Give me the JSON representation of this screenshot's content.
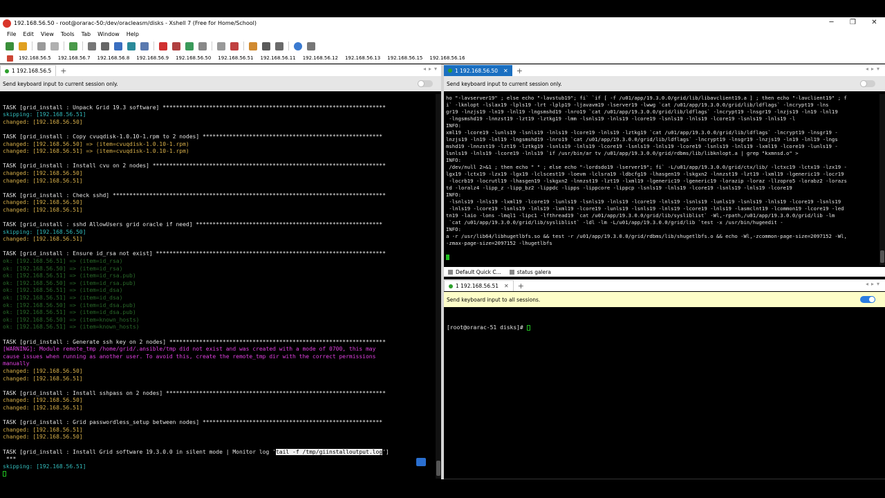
{
  "window": {
    "title": "192.168.56.50 - root@orarac-50:/dev/oracleasm/disks - Xshell 7 (Free for Home/School)",
    "controls": [
      "─",
      "❐",
      "✕"
    ]
  },
  "menu": [
    "File",
    "Edit",
    "View",
    "Tools",
    "Tab",
    "Window",
    "Help"
  ],
  "quick_hosts": [
    "192.168.56.5",
    "192.168.56.7",
    "192.168.56.8",
    "192.168.56.9",
    "192.168.56.50",
    "192.168.56.51",
    "192.168.56.11",
    "192.168.56.12",
    "192.168.56.13",
    "192.168.56.15",
    "192.168.56.16"
  ],
  "left_pane": {
    "tab_label": "1 192.168.56.5",
    "banner": "Send keyboard input to current session only.",
    "lines": [
      {
        "t": "",
        "c": "white"
      },
      {
        "t": "TASK [grid_install : Unpack Grid 19.3 software] *******************************************************************",
        "c": "white"
      },
      {
        "t": "skipping: [192.168.56.51]",
        "c": "cyan"
      },
      {
        "t": "changed: [192.168.56.50]",
        "c": "yellow"
      },
      {
        "t": "",
        "c": "white"
      },
      {
        "t": "TASK [grid_install : Copy cvuqdisk-1.0.10-1.rpm to 2 nodes] ******************************************************",
        "c": "white"
      },
      {
        "t": "changed: [192.168.56.50] => (item=cvuqdisk-1.0.10-1.rpm)",
        "c": "yellow"
      },
      {
        "t": "changed: [192.168.56.51] => (item=cvuqdisk-1.0.10-1.rpm)",
        "c": "yellow"
      },
      {
        "t": "",
        "c": "white"
      },
      {
        "t": "TASK [grid_install : Install cvu on 2 nodes] **********************************************************************",
        "c": "white"
      },
      {
        "t": "changed: [192.168.56.50]",
        "c": "yellow"
      },
      {
        "t": "changed: [192.168.56.51]",
        "c": "yellow"
      },
      {
        "t": "",
        "c": "white"
      },
      {
        "t": "TASK [grid_install : Check sshd] **********************************************************************************",
        "c": "white"
      },
      {
        "t": "changed: [192.168.56.50]",
        "c": "yellow"
      },
      {
        "t": "changed: [192.168.56.51]",
        "c": "yellow"
      },
      {
        "t": "",
        "c": "white"
      },
      {
        "t": "TASK [grid_install : sshd AllowUsers grid oracle if need] ********************************************************",
        "c": "white"
      },
      {
        "t": "skipping: [192.168.56.50]",
        "c": "cyan"
      },
      {
        "t": "changed: [192.168.56.51]",
        "c": "yellow"
      },
      {
        "t": "",
        "c": "white"
      },
      {
        "t": "TASK [grid_install : Ensure id_rsa not exist] *********************************************************************",
        "c": "white"
      },
      {
        "t": "ok: [192.168.56.51] => (item=id_rsa)",
        "c": "dgreen"
      },
      {
        "t": "ok: [192.168.56.50] => (item=id_rsa)",
        "c": "dgreen"
      },
      {
        "t": "ok: [192.168.56.51] => (item=id_rsa.pub)",
        "c": "dgreen"
      },
      {
        "t": "ok: [192.168.56.50] => (item=id_rsa.pub)",
        "c": "dgreen"
      },
      {
        "t": "ok: [192.168.56.51] => (item=id_dsa)",
        "c": "dgreen"
      },
      {
        "t": "ok: [192.168.56.51] => (item=id_dsa)",
        "c": "dgreen"
      },
      {
        "t": "ok: [192.168.56.50] => (item=id_dsa.pub)",
        "c": "dgreen"
      },
      {
        "t": "ok: [192.168.56.51] => (item=id_dsa.pub)",
        "c": "dgreen"
      },
      {
        "t": "ok: [192.168.56.50] => (item=known_hosts)",
        "c": "dgreen"
      },
      {
        "t": "ok: [192.168.56.51] => (item=known_hosts)",
        "c": "dgreen"
      },
      {
        "t": "",
        "c": "white"
      },
      {
        "t": "TASK [grid_install : Generate ssh key on 2 nodes] *****************************************************************",
        "c": "white"
      },
      {
        "t": "[WARNING]: Module remote_tmp /home/grid/.ansible/tmp did not exist and was created with a mode of 0700, this may",
        "c": "magenta"
      },
      {
        "t": "cause issues when running as another user. To avoid this, create the remote_tmp dir with the correct permissions",
        "c": "magenta"
      },
      {
        "t": "manually",
        "c": "magenta"
      },
      {
        "t": "changed: [192.168.56.50]",
        "c": "yellow"
      },
      {
        "t": "changed: [192.168.56.51]",
        "c": "yellow"
      },
      {
        "t": "",
        "c": "white"
      },
      {
        "t": "TASK [grid_install : Install sshpass on 2 nodes] ******************************************************************",
        "c": "white"
      },
      {
        "t": "changed: [192.168.56.50]",
        "c": "yellow"
      },
      {
        "t": "changed: [192.168.56.51]",
        "c": "yellow"
      },
      {
        "t": "",
        "c": "white"
      },
      {
        "t": "TASK [grid_install : Grid passwordless_setup between nodes] ******************************************************",
        "c": "white"
      },
      {
        "t": "changed: [192.168.56.51]",
        "c": "yellow"
      },
      {
        "t": "changed: [192.168.56.50]",
        "c": "yellow"
      },
      {
        "t": "",
        "c": "white"
      }
    ],
    "final_task_prefix": "TASK [grid_install : Install Grid software 19.3.0.0 in silent mode | Monitor log '",
    "final_task_highlight": "tail -f /tmp/giinstalloutput.log",
    "final_task_suffix": "']",
    "final_task_cont": " ***",
    "final_skip": "skipping: [192.168.56.51]"
  },
  "right_top_pane": {
    "tab_label": "1 192.168.56.50",
    "banner": "Send keyboard input to current session only.",
    "lines": [
      "ho \"-lavserver19\" ; else echo \"-lavstub19\"; fi` `if [ -f /u01/app/19.3.0.0/grid/lib/libavclient19.a ] ; then echo \"-lavclient19\" ; f",
      "i` -lknlopt -lslax19 -lpls19 -lrt -lplp19 -ljavavm19 -lserver19 -lwwg `cat /u01/app/19.3.0.0/grid/lib/ldflags` -lncrypt19 -lns",
      "gr19 -lnzjs19 -ln19 -lnl19 -lngsmshd19 -lnro19 `cat /u01/app/19.3.0.0/grid/lib/ldflags` -lncrypt19 -lnsgr19 -lnzjs19 -ln19 -lnl19",
      " -lngsmshd19 -lnnzst19 -lzt19 -lztkg19 -lmm -lsnls19 -lnls19 -lcore19 -lsnls19 -lnls19 -lcore19 -lsnls19 -lnls19 -l",
      "INFO:",
      "xml19 -lcore19 -lunls19 -lsnls19 -lnls19 -lcore19 -lnls19 -lztkg19 `cat /u01/app/19.3.0.0/grid/lib/ldflags` -lncrypt19 -lnsgr19 -",
      "lnzjs19 -ln19 -lnl19 -lngsmshd19 -lnro19 `cat /u01/app/19.3.0.0/grid/lib/ldflags` -lncrypt19 -lnsgr19 -lnzjs19 -ln19 -lnl19 -lngs",
      "mshd19 -lnnzst19 -lzt19 -lztkg19 -lsnls19 -lnls19 -lcore19 -lsnls19 -lnls19 -lcore19 -lsnls19 -lnls19 -lxml19 -lcore19 -lunls19 -",
      "lsnls19 -lnls19 -lcore19 -lnls19 `if /usr/bin/ar tv /u01/app/19.3.0.0/grid/rdbms/lib/libknlopt.a | grep \"kxmnsd.o\" >",
      "INFO:",
      " /dev/null 2>&1 ; then echo \" \" ; else echo \"-lordsdo19 -lserver19\"; fi` -L/u01/app/19.3.0.0/grid/ctx/lib/ -lctxc19 -lctx19 -lzx19 -",
      "lgx19 -lctx19 -lzx19 -lgx19 -lclscest19 -loevm -lclsra19 -ldbcfg19 -lhasgen19 -lskgxn2 -lnnzst19 -lzt19 -lxml19 -lgeneric19 -locr19",
      " -locrb19 -locrutl19 -lhasgen19 -lskgxn2 -lnnzst19 -lzt19 -lxml19 -lgeneric19 -lgeneric19 -lorazip -loraz -llzopro5 -lorabz2 -lorazs",
      "td -loralz4 -lipp_z -lipp_bz2 -lippdc -lipps -lippcore -lippcp -lsnls19 -lnls19 -lcore19 -lsnls19 -lnls19 -lcore19",
      "INFO:",
      " -lsnls19 -lnls19 -lxml19 -lcore19 -lunls19 -lsnls19 -lnls19 -lcore19 -lnls19 -lsnls19 -lunls19 -lsnls19 -lnls19 -lcore19 -lsnls19",
      " -lnls19 -lcore19 -lsnls19 -lnls19 -lxml19 -lcore19 -lunls19 -lsnls19 -lnls19 -lcore19 -lnls19 -lasmclnt19 -lcommon19 -lcore19 -led",
      "tn19 -laio -lons -lmql1 -lipc1 -lfthread19 `cat /u01/app/19.3.0.0/grid/lib/sysliblist` -Wl,-rpath,/u01/app/19.3.0.0/grid/lib -lm",
      " `cat /u01/app/19.3.0.0/grid/lib/sysliblist` -ldl -lm -L/u01/app/19.3.0.0/grid/lib `test -x /usr/bin/hugeedit -",
      "INFO:",
      "a -r /usr/lib64/libhugetlbfs.so && test -r /u01/app/19.3.0.0/grid/rdbms/lib/shugetlbfs.o && echo -Wl,-zcommon-page-size=2097152 -Wl,",
      "-zmax-page-size=2097152 -lhugetlbfs"
    ]
  },
  "quick_commands": [
    "Default Quick C...",
    "status galera"
  ],
  "right_bottom_pane": {
    "tab_label": "1 192.168.56.51",
    "banner": "Send keyboard input to all sessions.",
    "prompt": "[root@orarac-51 disks]# "
  }
}
